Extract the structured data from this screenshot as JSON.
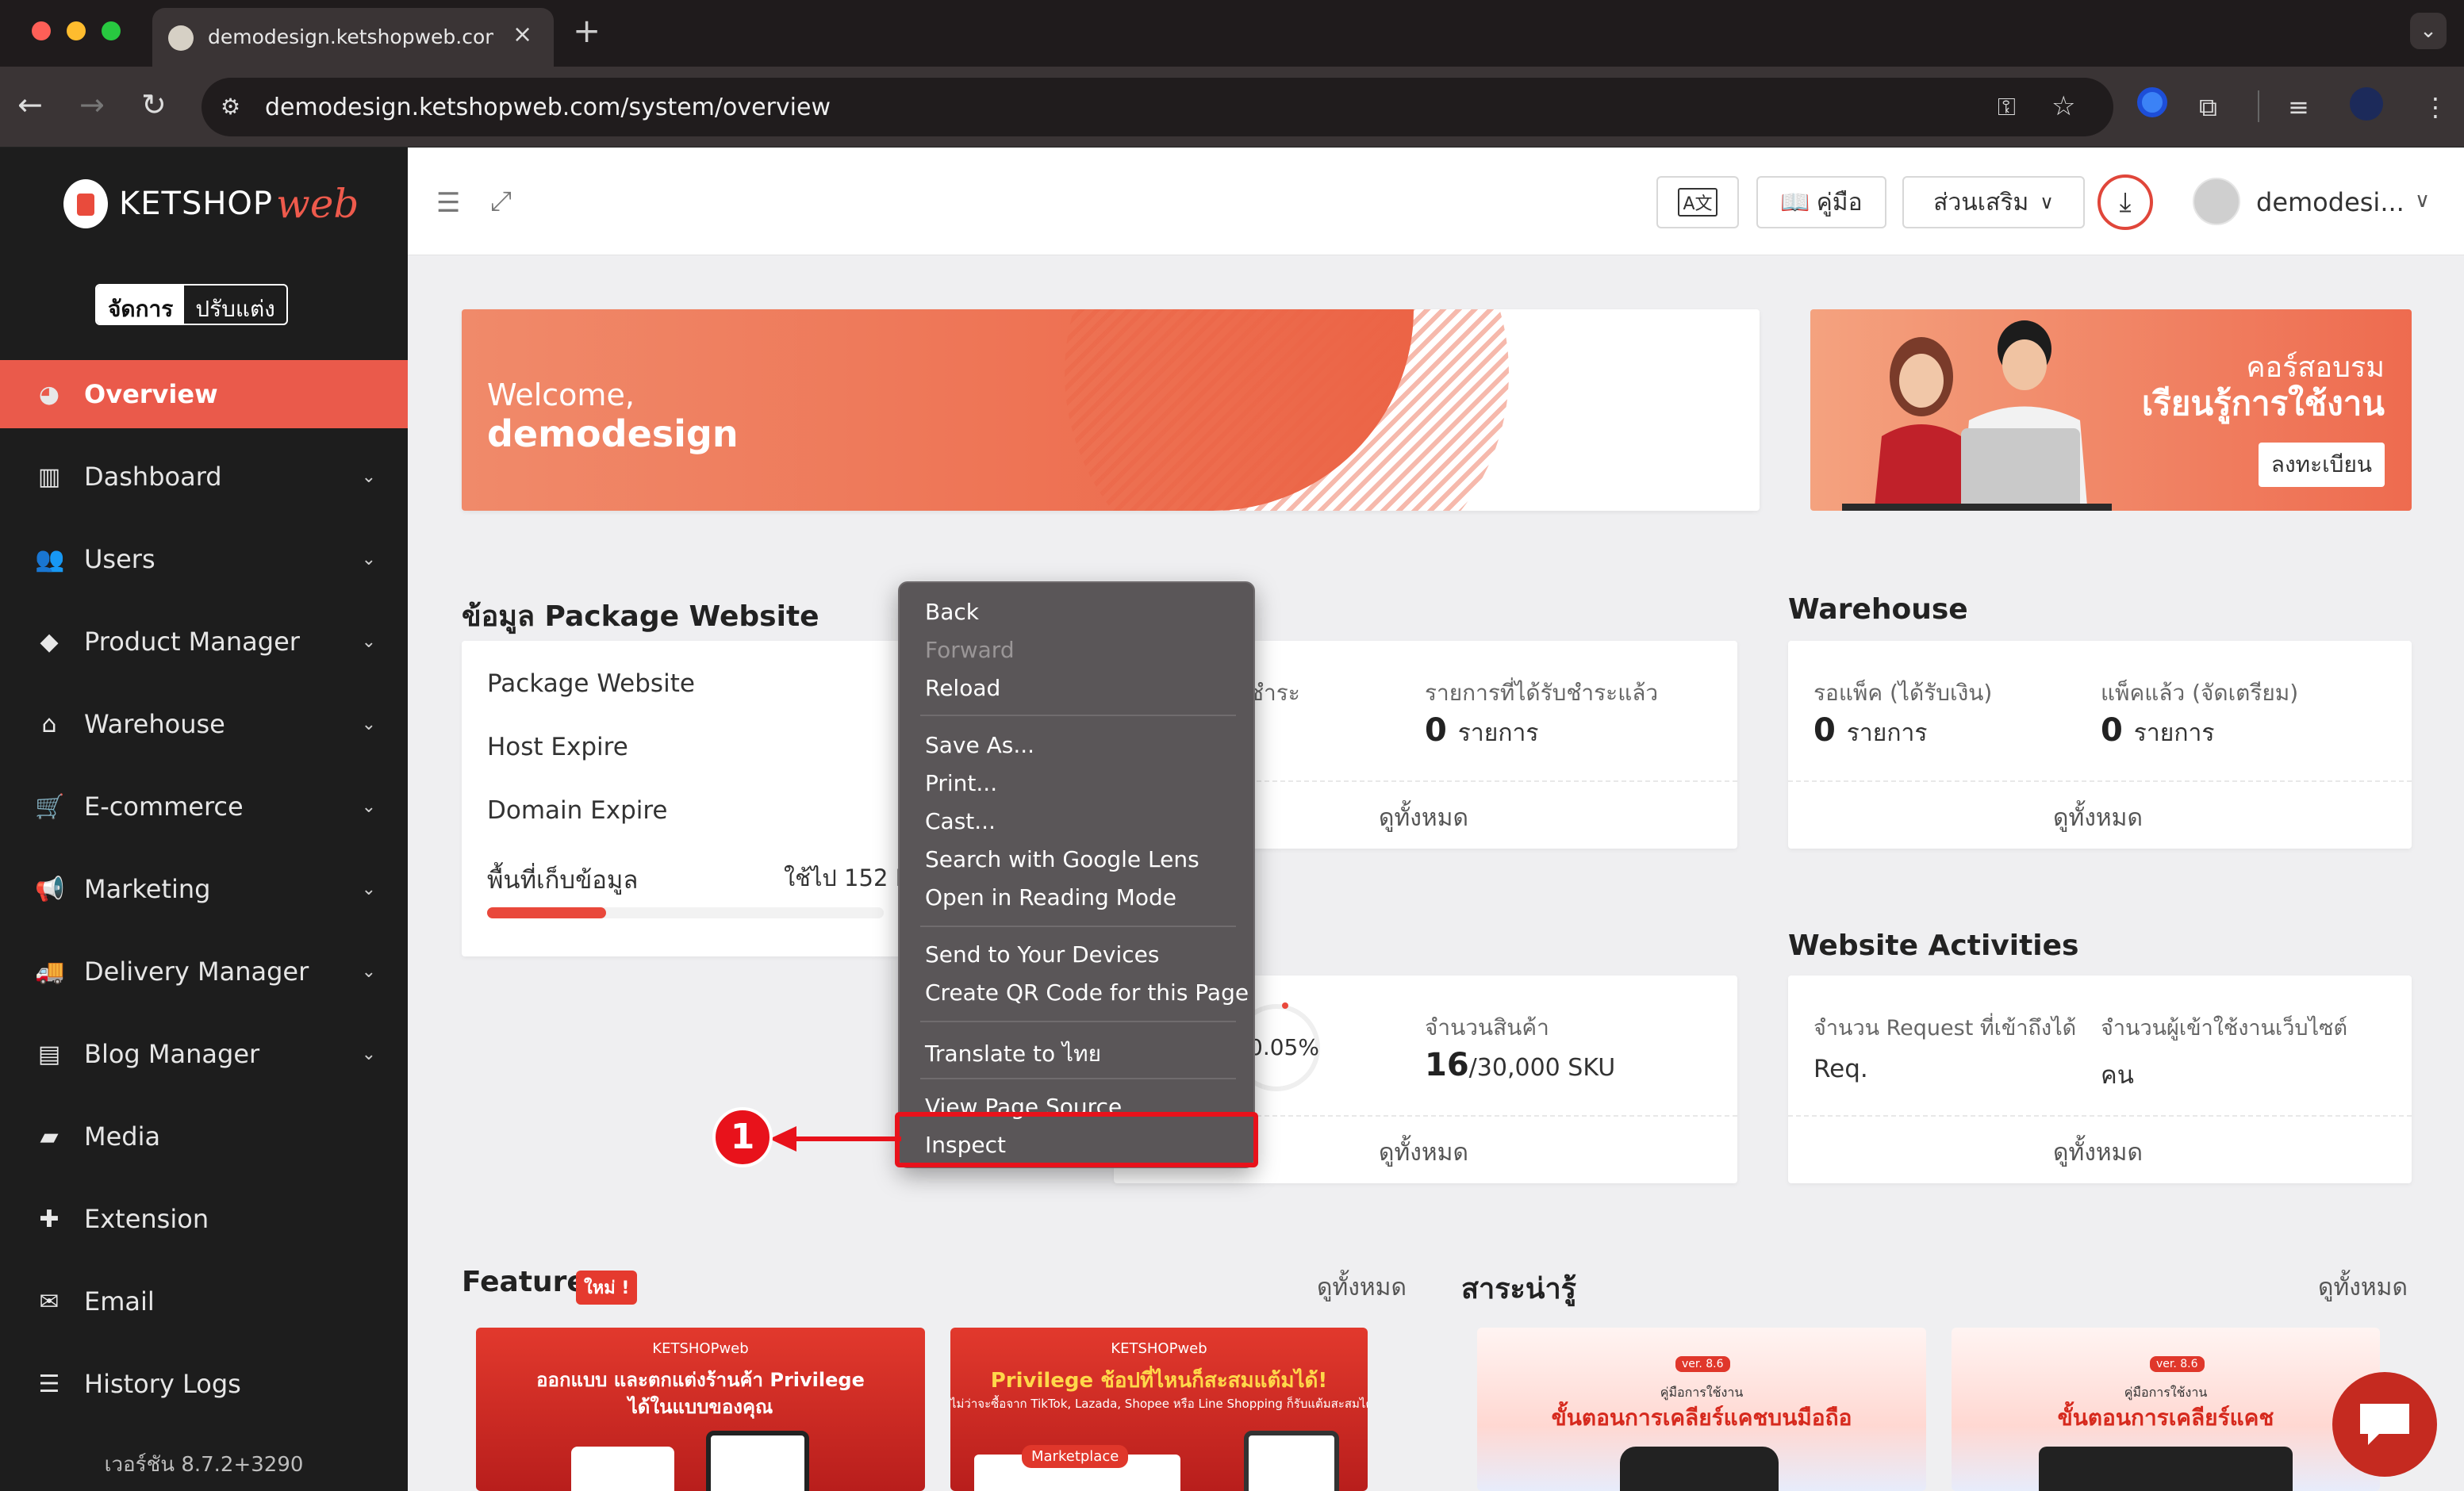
{
  "browser": {
    "tab_title": "demodesign.ketshopweb.com",
    "tab_close": "×",
    "new_tab": "+",
    "url": "demodesign.ketshopweb.com/system/overview"
  },
  "sidebar": {
    "logo_text": "KETSHOP",
    "logo_script": "web",
    "mode_manage": "จัดการ",
    "mode_customize": "ปรับแต่ง",
    "items": [
      {
        "label": "Overview",
        "icon": "pie-chart-icon"
      },
      {
        "label": "Dashboard",
        "icon": "bar-chart-icon"
      },
      {
        "label": "Users",
        "icon": "users-icon"
      },
      {
        "label": "Product Manager",
        "icon": "tags-icon"
      },
      {
        "label": "Warehouse",
        "icon": "warehouse-icon"
      },
      {
        "label": "E-commerce",
        "icon": "cart-icon"
      },
      {
        "label": "Marketing",
        "icon": "megaphone-icon"
      },
      {
        "label": "Delivery Manager",
        "icon": "truck-icon"
      },
      {
        "label": "Blog Manager",
        "icon": "newspaper-icon"
      },
      {
        "label": "Media",
        "icon": "folder-icon"
      },
      {
        "label": "Extension",
        "icon": "puzzle-icon"
      },
      {
        "label": "Email",
        "icon": "envelope-icon"
      },
      {
        "label": "History Logs",
        "icon": "list-icon"
      }
    ],
    "version": "เวอร์ชัน 8.7.2+3290"
  },
  "header": {
    "manual": "คู่มือ",
    "addons": "ส่วนเสริม",
    "username": "demodesi..."
  },
  "welcome": {
    "greeting": "Welcome,",
    "name": "demodesign"
  },
  "course_banner": {
    "line1": "คอร์สอบรม",
    "line2": "เรียนรู้การใช้งาน",
    "button": "ลงทะเบียน"
  },
  "package": {
    "title": "ข้อมูล Package Website",
    "rows": [
      "Package Website",
      "Host Expire",
      "Domain Expire"
    ],
    "storage_label": "พื้นที่เก็บข้อมูล",
    "storage_used": "ใช้ไป 152 MB",
    "storage_fraction": 0.3
  },
  "orders": {
    "partial_label": "ชำระ",
    "paid_label": "รายการที่ได้รับชำระแล้ว",
    "paid_count": "0",
    "unit": "รายการ",
    "view_all": "ดูทั้งหมด"
  },
  "warehouse": {
    "title": "Warehouse",
    "col1_label": "รอแพ็ค (ได้รับเงิน)",
    "col1_value": "0",
    "col2_label": "แพ็คแล้ว (จัดเตรียม)",
    "col2_value": "0",
    "unit": "รายการ",
    "view_all": "ดูทั้งหมด"
  },
  "products": {
    "percent": "0.05%",
    "sku_label": "จำนวนสินค้า",
    "sku_value": "16",
    "sku_total": "/30,000 SKU",
    "view_all": "ดูทั้งหมด"
  },
  "activities": {
    "title": "Website Activities",
    "col1_label": "จำนวน Request ที่เข้าถึงได้",
    "col1_value": "Req.",
    "col2_label": "จำนวนผู้เข้าใช้งานเว็บไซต์",
    "col2_value": "คน",
    "view_all": "ดูทั้งหมด"
  },
  "feature": {
    "title": "Feature",
    "badge": "ใหม่ !",
    "view_all": "ดูทั้งหมด",
    "card1_brand": "KETSHOPweb",
    "card1_line1": "ออกแบบ และตกแต่งร้านค้า Privilege",
    "card1_line2": "ได้ในแบบของคุณ",
    "card2_brand": "KETSHOPweb",
    "card2_line1": "Privilege ช้อปที่ไหนก็สะสมแต้มได้!",
    "card2_line2": "ไม่ว่าจะซื้อจาก TikTok, Lazada, Shopee หรือ Line Shopping ก็รับแต้มสะสมได้",
    "card2_tag": "Marketplace"
  },
  "articles": {
    "title": "สาระน่ารู้",
    "view_all": "ดูทั้งหมด",
    "card1_ver": "ver. 8.6",
    "card1_sub": "คู่มือการใช้งาน",
    "card1_title": "ขั้นตอนการเคลียร์แคชบนมือถือ",
    "card2_ver": "ver. 8.6",
    "card2_sub": "คู่มือการใช้งาน",
    "card2_title": "ขั้นตอนการเคลียร์แคช"
  },
  "context_menu": {
    "items": [
      "Back",
      "Forward",
      "Reload",
      "Save As...",
      "Print...",
      "Cast...",
      "Search with Google Lens",
      "Open in Reading Mode",
      "Send to Your Devices",
      "Create QR Code for this Page",
      "Translate to ไทย",
      "View Page Source",
      "Inspect"
    ],
    "annotation": "1"
  },
  "colors": {
    "accent": "#ea5a4b",
    "highlight": "#e8121b",
    "sidebar_bg": "#1d1d1d",
    "menu_bg": "#5a5658"
  }
}
